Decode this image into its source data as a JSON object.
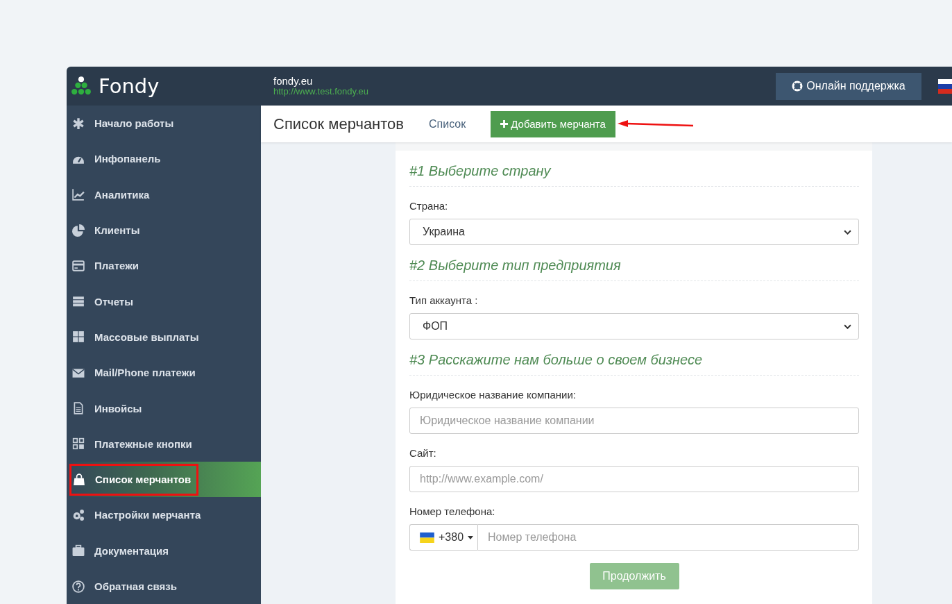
{
  "header": {
    "logo": "Fondy",
    "site_name": "fondy.eu",
    "site_url": "http://www.test.fondy.eu",
    "support_button": "Онлайн поддержка"
  },
  "sidebar": {
    "items": [
      {
        "label": "Начало работы",
        "selected": false
      },
      {
        "label": "Инфопанель",
        "selected": false
      },
      {
        "label": "Аналитика",
        "selected": false
      },
      {
        "label": "Клиенты",
        "selected": false
      },
      {
        "label": "Платежи",
        "selected": false
      },
      {
        "label": "Отчеты",
        "selected": false
      },
      {
        "label": "Массовые выплаты",
        "selected": false
      },
      {
        "label": "Mail/Phone платежи",
        "selected": false
      },
      {
        "label": "Инвойсы",
        "selected": false
      },
      {
        "label": "Платежные кнопки",
        "selected": false
      },
      {
        "label": "Список мерчантов",
        "selected": true
      },
      {
        "label": "Настройки мерчанта",
        "selected": false
      },
      {
        "label": "Документация",
        "selected": false
      },
      {
        "label": "Обратная связь",
        "selected": false
      }
    ]
  },
  "page": {
    "title": "Список мерчантов",
    "tabs": [
      {
        "label": "Список",
        "selected": false
      },
      {
        "label": "Добавить мерчанта",
        "selected": true
      }
    ]
  },
  "form": {
    "sections": [
      {
        "heading": "#1 Выберите страну",
        "fields": [
          {
            "kind": "select",
            "label": "Страна:",
            "value": "Украина"
          }
        ]
      },
      {
        "heading": "#2 Выберите тип предприятия",
        "fields": [
          {
            "kind": "select",
            "label": "Тип аккаунта :",
            "value": "ФОП"
          }
        ]
      },
      {
        "heading": "#3 Расскажите нам больше о своем бизнесе",
        "fields": [
          {
            "kind": "text",
            "label": "Юридическое название компании:",
            "placeholder": "Юридическое название компании"
          },
          {
            "kind": "text",
            "label": "Сайт:",
            "placeholder": "http://www.example.com/"
          },
          {
            "kind": "phone",
            "label": "Номер телефона:",
            "code": "+380",
            "placeholder": "Номер телефона"
          }
        ]
      }
    ],
    "submit": {
      "label": "Продолжить",
      "disabled": true
    }
  }
}
